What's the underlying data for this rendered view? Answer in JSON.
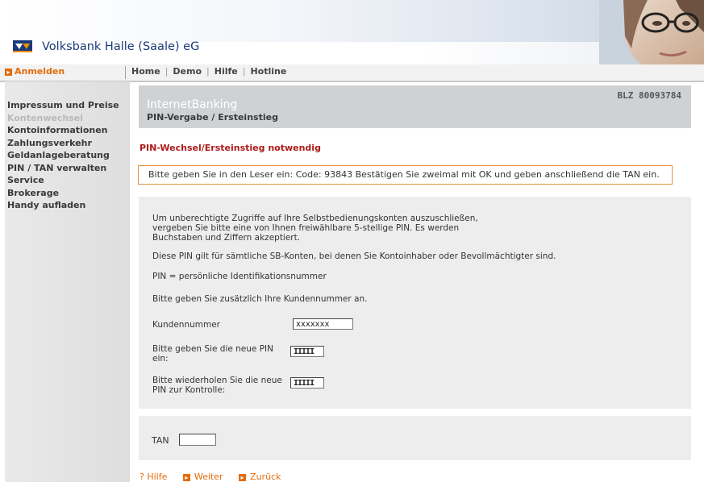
{
  "header": {
    "bank_name": "Volksbank Halle (Saale) eG"
  },
  "navbar": {
    "login_label": "Anmelden",
    "links": [
      "Home",
      "Demo",
      "Hilfe",
      "Hotline"
    ]
  },
  "sidebar": {
    "items": [
      {
        "label": "Impressum und Preise"
      },
      {
        "label": "Kontenwechsel"
      },
      {
        "label": "Kontoinformationen"
      },
      {
        "label": "Zahlungsverkehr"
      },
      {
        "label": "Geldanlageberatung"
      },
      {
        "label": "PIN / TAN verwalten"
      },
      {
        "label": "Service"
      },
      {
        "label": "Brokerage"
      },
      {
        "label": "Handy aufladen"
      }
    ]
  },
  "title_block": {
    "title": "InternetBanking",
    "subtitle": "PIN-Vergabe / Ersteinstieg",
    "blz": "BLZ 80093784"
  },
  "warning": {
    "title": "PIN-Wechsel/Ersteinstieg notwendig",
    "info": "Bitte geben Sie in den Leser ein: Code: 93843 Bestätigen Sie zweimal mit OK und geben anschließend die TAN ein."
  },
  "form": {
    "intro_line1": "Um unberechtigte Zugriffe auf Ihre Selbstbedienungskonten auszuschließen,",
    "intro_line2": "vergeben Sie bitte eine von Ihnen freiwählbare 5-stellige PIN. Es werden",
    "intro_line3": "Buchstaben und Ziffern akzeptiert.",
    "sb_text": "Diese PIN gilt für sämtliche SB-Konten, bei denen Sie Kontoinhaber oder Bevollmächtigter sind.",
    "pin_def": "PIN = persönliche Identifikationsnummer",
    "customer_hint": "Bitte geben Sie zusätzlich Ihre Kundennummer an.",
    "customer_label": "Kundennummer",
    "customer_value": "xxxxxxx",
    "new_pin_line1": "Bitte geben Sie die neue PIN",
    "new_pin_line2": "ein:",
    "new_pin_value": "IIIII",
    "repeat_pin_line1": "Bitte wiederholen Sie die neue",
    "repeat_pin_line2": "PIN zur Kontrolle:",
    "repeat_pin_value": "IIIII"
  },
  "tan": {
    "label": "TAN",
    "value": ""
  },
  "footer": {
    "help": "Hilfe",
    "help_glyph": "?",
    "next": "Weiter",
    "back": "Zurück"
  }
}
